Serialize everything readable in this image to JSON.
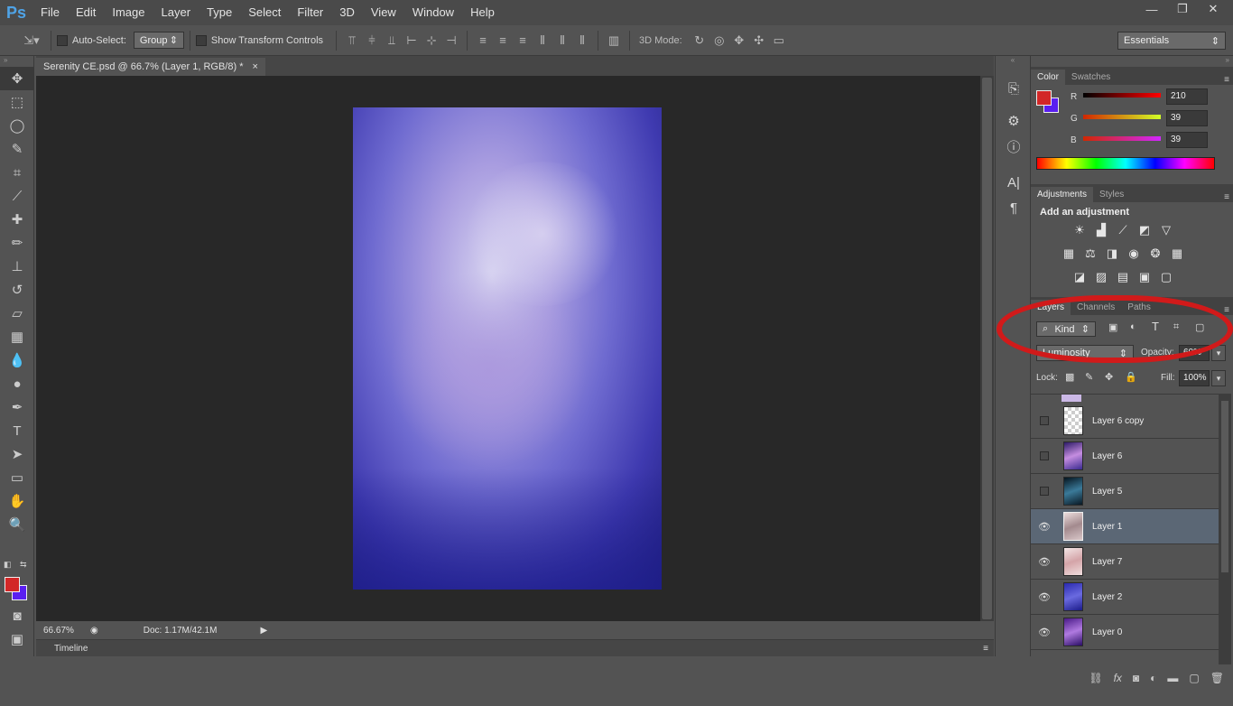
{
  "app": {
    "logo": "Ps"
  },
  "menu": [
    "File",
    "Edit",
    "Image",
    "Layer",
    "Type",
    "Select",
    "Filter",
    "3D",
    "View",
    "Window",
    "Help"
  ],
  "window_controls": {
    "minimize": "—",
    "restore": "❐",
    "close": "✕"
  },
  "options": {
    "auto_select_label": "Auto-Select:",
    "auto_select_value": "Group",
    "show_transform_label": "Show Transform Controls",
    "mode3d_label": "3D Mode:",
    "workspace": "Essentials"
  },
  "document": {
    "tab_title": "Serenity CE.psd @ 66.7% (Layer 1, RGB/8) *",
    "close": "×",
    "zoom": "66.67%",
    "doc_info": "Doc: 1.17M/42.1M"
  },
  "timeline": {
    "label": "Timeline"
  },
  "color_panel": {
    "tabs": [
      "Color",
      "Swatches"
    ],
    "r_label": "R",
    "g_label": "G",
    "b_label": "B",
    "r": "210",
    "g": "39",
    "b": "39",
    "foreground": "#d22727",
    "background": "#5a1ff0"
  },
  "adjustments_panel": {
    "tabs": [
      "Adjustments",
      "Styles"
    ],
    "heading": "Add an adjustment"
  },
  "layers_panel": {
    "tabs": [
      "Layers",
      "Channels",
      "Paths"
    ],
    "filter_kind": "Kind",
    "blend_mode": "Luminosity",
    "opacity_label": "Opacity:",
    "opacity": "60%",
    "lock_label": "Lock:",
    "fill_label": "Fill:",
    "fill": "100%",
    "layers": [
      {
        "name": "Layer 6 copy",
        "visible": false
      },
      {
        "name": "Layer 6",
        "visible": false
      },
      {
        "name": "Layer 5",
        "visible": false
      },
      {
        "name": "Layer 1",
        "visible": true,
        "selected": true
      },
      {
        "name": "Layer 7",
        "visible": true
      },
      {
        "name": "Layer 2",
        "visible": true
      },
      {
        "name": "Layer 0",
        "visible": true
      }
    ],
    "footer_icons": [
      "link-icon",
      "fx-icon",
      "mask-icon",
      "adjustment-icon",
      "folder-icon",
      "new-layer-icon",
      "trash-icon"
    ]
  },
  "annotation": {
    "color": "#d11a1a"
  }
}
